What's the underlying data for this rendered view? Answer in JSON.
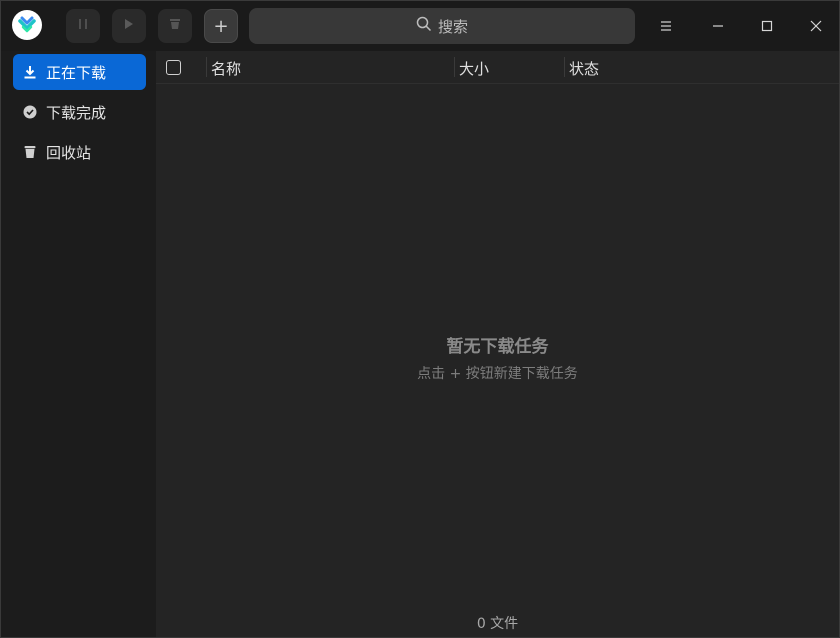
{
  "toolbar": {
    "add_label": "+",
    "search_placeholder": "搜索"
  },
  "sidebar": {
    "items": [
      {
        "label": "正在下载",
        "icon": "download-icon",
        "selected": true
      },
      {
        "label": "下载完成",
        "icon": "check-circle-icon",
        "selected": false
      },
      {
        "label": "回收站",
        "icon": "trash-icon",
        "selected": false
      }
    ]
  },
  "table": {
    "columns": [
      "名称",
      "大小",
      "状态"
    ]
  },
  "empty": {
    "title": "暂无下载任务",
    "hint": "点击 + 按钮新建下载任务"
  },
  "footer": {
    "count": "0 文件"
  },
  "colors": {
    "accent": "#0a68d6",
    "background": "#242424",
    "sidebar": "#1c1c1c"
  }
}
